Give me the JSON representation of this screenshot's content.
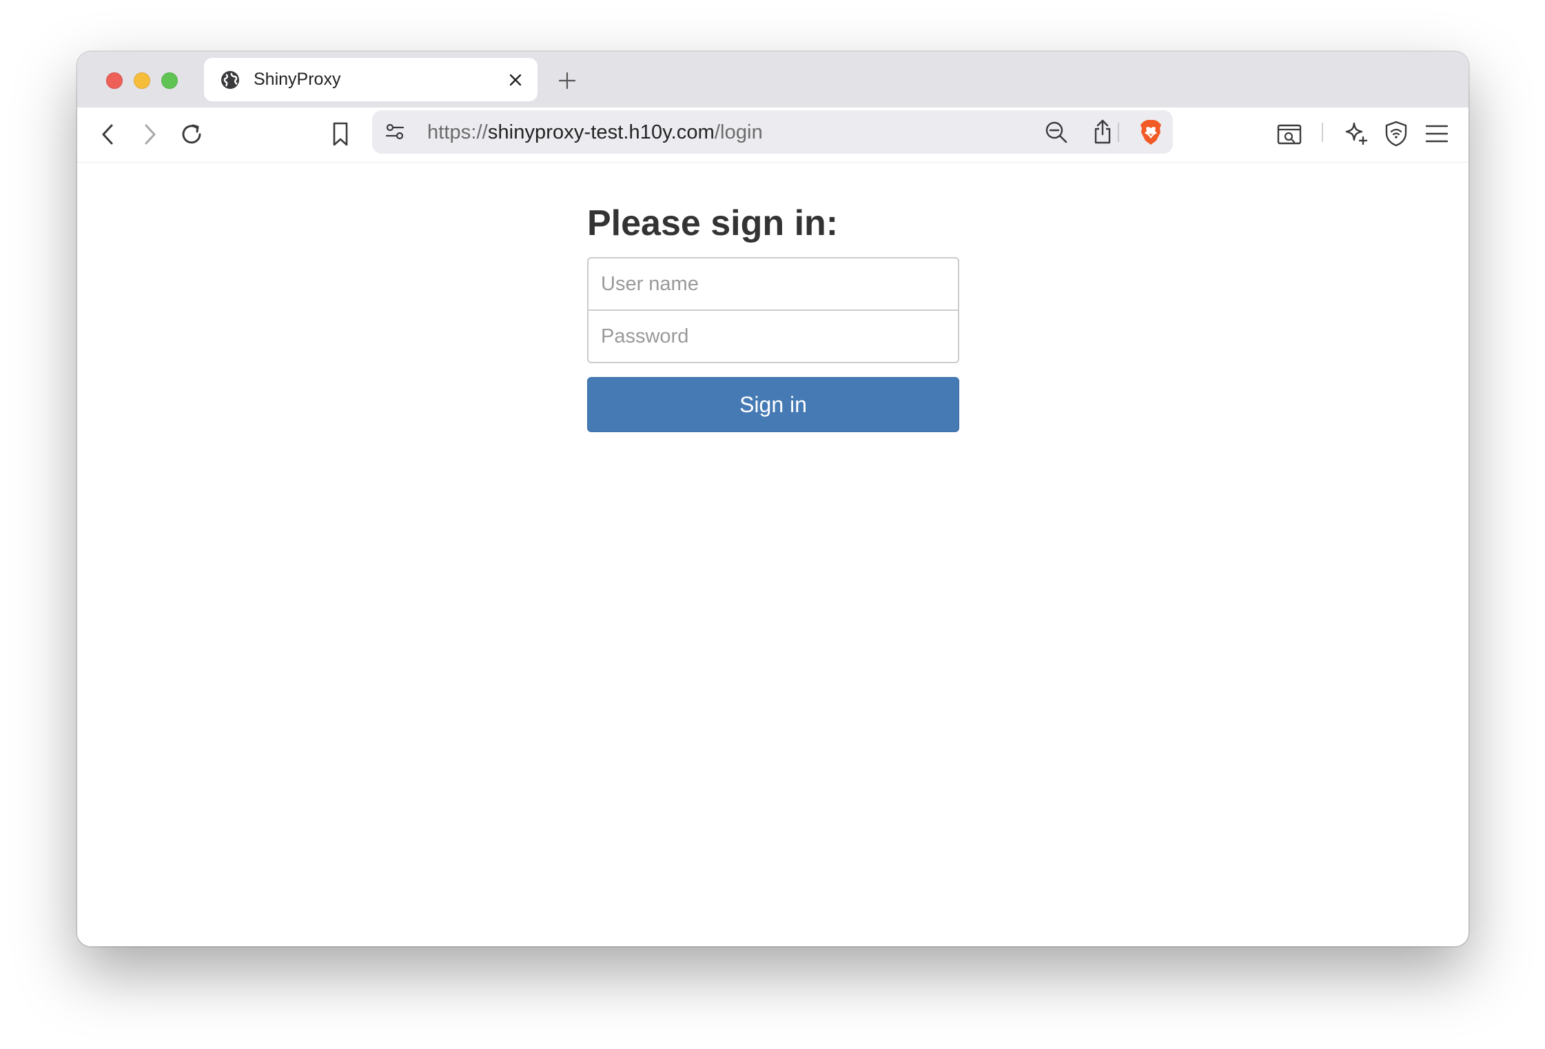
{
  "browser": {
    "tab": {
      "title": "ShinyProxy",
      "icon": "globe-icon"
    },
    "address_bar": {
      "proto": "https://",
      "host": "shinyproxy-test.h10y.com",
      "path": "/login"
    },
    "colors": {
      "brave_shield": "#f15a24",
      "tabbar": "#e2e2e7"
    }
  },
  "login": {
    "heading": "Please sign in:",
    "username_placeholder": "User name",
    "password_placeholder": "Password",
    "submit_label": "Sign in",
    "button_color": "#467ab4"
  }
}
